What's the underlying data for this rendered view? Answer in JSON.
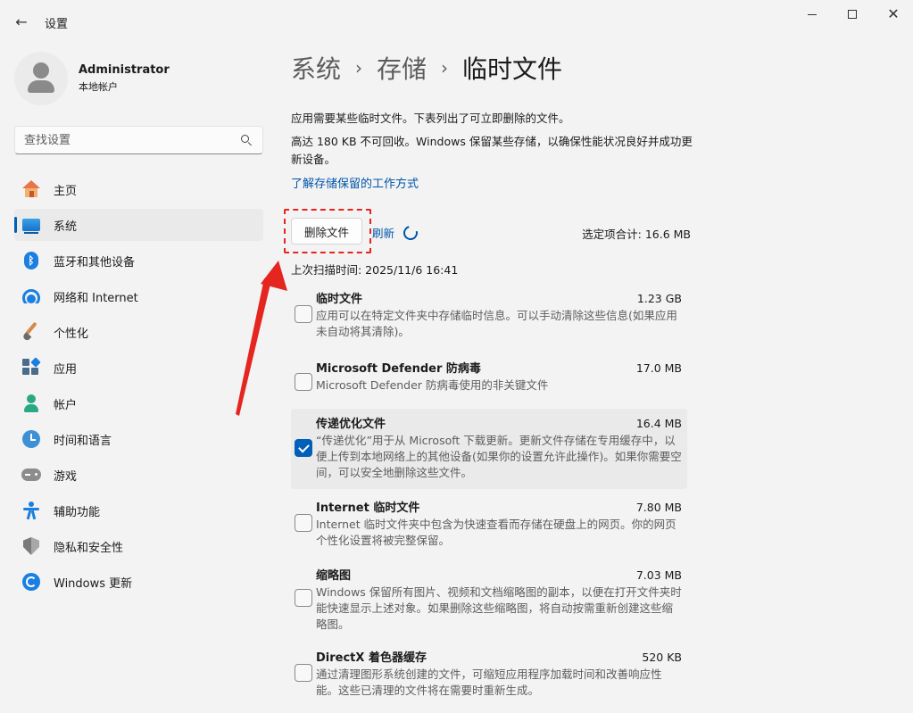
{
  "window": {
    "title": "设置",
    "controls": [
      "minimize",
      "maximize",
      "close"
    ]
  },
  "user": {
    "name": "Administrator",
    "type": "本地帐户"
  },
  "search": {
    "placeholder": "查找设置"
  },
  "sidebar": {
    "items": [
      {
        "label": "主页",
        "icon": "home-icon",
        "active": false
      },
      {
        "label": "系统",
        "icon": "system-icon",
        "active": true
      },
      {
        "label": "蓝牙和其他设备",
        "icon": "bluetooth-icon",
        "active": false
      },
      {
        "label": "网络和 Internet",
        "icon": "wifi-icon",
        "active": false
      },
      {
        "label": "个性化",
        "icon": "brush-icon",
        "active": false
      },
      {
        "label": "应用",
        "icon": "apps-icon",
        "active": false
      },
      {
        "label": "帐户",
        "icon": "account-icon",
        "active": false
      },
      {
        "label": "时间和语言",
        "icon": "time-language-icon",
        "active": false
      },
      {
        "label": "游戏",
        "icon": "gaming-icon",
        "active": false
      },
      {
        "label": "辅助功能",
        "icon": "accessibility-icon",
        "active": false
      },
      {
        "label": "隐私和安全性",
        "icon": "shield-icon",
        "active": false
      },
      {
        "label": "Windows 更新",
        "icon": "windows-update-icon",
        "active": false
      }
    ]
  },
  "breadcrumb": {
    "items": [
      "系统",
      "存储"
    ],
    "current": "临时文件",
    "separator": "›"
  },
  "main": {
    "description": "应用需要某些临时文件。下表列出了可立即删除的文件。",
    "reserved_note": "高达 180 KB 不可回收。Windows 保留某些存储，以确保性能状况良好并成功更新设备。",
    "learn_link": "了解存储保留的工作方式",
    "delete_button": "删除文件",
    "refresh_label": "刷新",
    "selected_total": "选定项合计: 16.6 MB",
    "last_scan": "上次扫描时间: 2025/11/6 16:41"
  },
  "files": [
    {
      "title": "临时文件",
      "size": "1.23 GB",
      "checked": false,
      "description": "应用可以在特定文件夹中存储临时信息。可以手动清除这些信息(如果应用未自动将其清除)。"
    },
    {
      "title": "Microsoft Defender 防病毒",
      "size": "17.0 MB",
      "checked": false,
      "description": "Microsoft Defender 防病毒使用的非关键文件"
    },
    {
      "title": "传递优化文件",
      "size": "16.4 MB",
      "checked": true,
      "description": "“传递优化”用于从 Microsoft 下载更新。更新文件存储在专用缓存中，以便上传到本地网络上的其他设备(如果你的设置允许此操作)。如果你需要空间，可以安全地删除这些文件。"
    },
    {
      "title": "Internet 临时文件",
      "size": "7.80 MB",
      "checked": false,
      "description": "Internet 临时文件夹中包含为快速查看而存储在硬盘上的网页。你的网页个性化设置将被完整保留。"
    },
    {
      "title": "缩略图",
      "size": "7.03 MB",
      "checked": false,
      "description": "Windows 保留所有图片、视频和文档缩略图的副本，以便在打开文件夹时能快速显示上述对象。如果删除这些缩略图，将自动按需重新创建这些缩略图。"
    },
    {
      "title": "DirectX 着色器缓存",
      "size": "520 KB",
      "checked": false,
      "description": "通过清理图形系统创建的文件，可缩短应用程序加载时间和改善响应性能。这些已清理的文件将在需要时重新生成。"
    }
  ],
  "annotation": {
    "highlight_color": "#e5251f",
    "accent_color": "#005fb8"
  }
}
